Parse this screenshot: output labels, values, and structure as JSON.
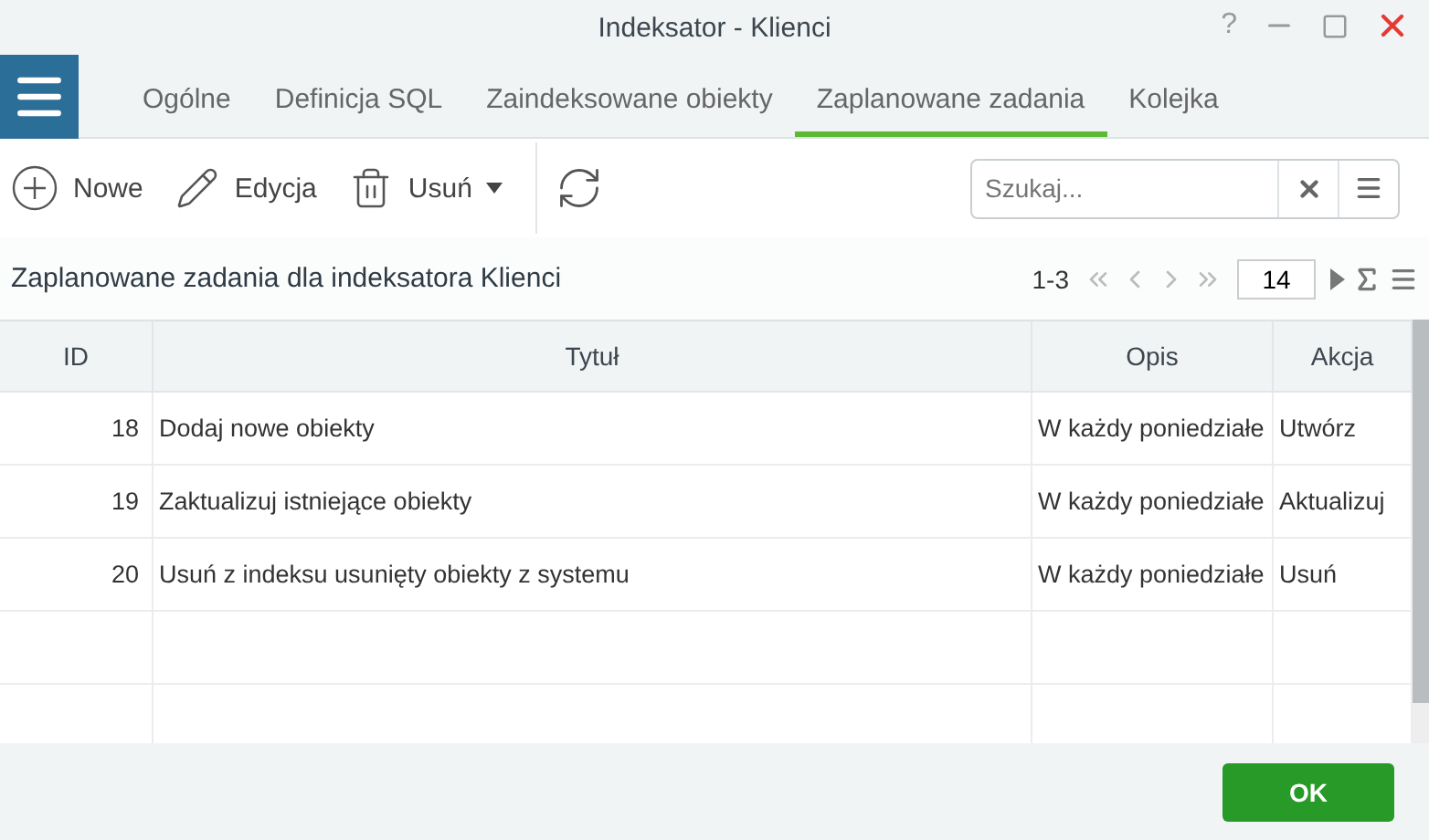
{
  "window": {
    "title": "Indeksator - Klienci",
    "controls": [
      "?"
    ]
  },
  "tabs": [
    {
      "label": "Ogólne",
      "selected": false
    },
    {
      "label": "Definicja SQL",
      "selected": false
    },
    {
      "label": "Zaindeksowane obiekty",
      "selected": false
    },
    {
      "label": "Zaplanowane zadania",
      "selected": true
    },
    {
      "label": "Kolejka",
      "selected": false
    }
  ],
  "toolbar": [
    {
      "kind": "new",
      "label": "Nowe"
    },
    {
      "kind": "edit",
      "label": "Edycja"
    },
    {
      "kind": "delete",
      "label": "Usuń"
    },
    {
      "kind": "refresh"
    }
  ],
  "search": {
    "placeholder": "Szukaj..."
  },
  "section_title": "Zaplanowane zadania dla indeksatora Klienci",
  "pager": {
    "range": "1-3",
    "page_size": "14"
  },
  "table": {
    "columns": [
      "ID",
      "Tytuł",
      "Opis",
      "Akcja"
    ],
    "rows": [
      [
        "18",
        "Dodaj nowe obiekty",
        "W każdy poniedziałe",
        "Utwórz"
      ],
      [
        "19",
        "Zaktualizuj istniejące obiekty",
        "W każdy poniedziałe",
        "Aktualizuj"
      ],
      [
        "20",
        "Usuń z indeksu usunięty obiekty z systemu",
        "W każdy poniedziałe",
        "Usuń"
      ]
    ]
  },
  "buttons": [
    "OK"
  ]
}
